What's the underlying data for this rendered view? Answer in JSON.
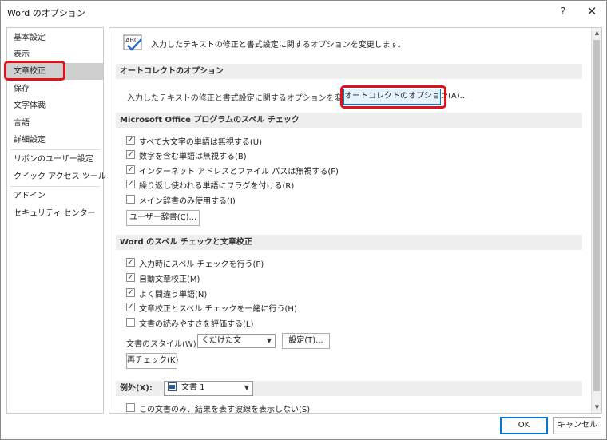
{
  "window": {
    "title": "Word のオプション",
    "help": "?",
    "close": "✕"
  },
  "sidebar": {
    "items": [
      {
        "label": "基本設定"
      },
      {
        "label": "表示"
      },
      {
        "label": "文章校正"
      },
      {
        "label": "保存"
      },
      {
        "label": "文字体裁"
      },
      {
        "label": "言語"
      },
      {
        "label": "詳細設定"
      },
      {
        "label": "リボンのユーザー設定"
      },
      {
        "label": "クイック アクセス ツール バー"
      },
      {
        "label": "アドイン"
      },
      {
        "label": "セキュリティ センター"
      }
    ],
    "selected": "文章校正"
  },
  "header": {
    "icon_label": "ABC",
    "text": "入力したテキストの修正と書式設定に関するオプションを変更します。"
  },
  "autocorrect": {
    "section_title": "オートコレクトのオプション",
    "description": "入力したテキストの修正と書式設定に関するオプションを変更します。",
    "button": "オートコレクトのオプション(A)..."
  },
  "spell_office": {
    "section_title": "Microsoft Office プログラムのスペル チェック",
    "options": [
      {
        "label": "すべて大文字の単語は無視する(U)",
        "checked": "✓"
      },
      {
        "label": "数字を含む単語は無視する(B)",
        "checked": "✓"
      },
      {
        "label": "インターネット アドレスとファイル パスは無視する(F)",
        "checked": "✓"
      },
      {
        "label": "繰り返し使われる単語にフラグを付ける(R)",
        "checked": "✓"
      },
      {
        "label": "メイン辞書のみ使用する(I)",
        "checked": ""
      }
    ],
    "dict_button": "ユーザー辞書(C)..."
  },
  "word_spell": {
    "section_title": "Word のスペル チェックと文章校正",
    "options": [
      {
        "label": "入力時にスペル チェックを行う(P)",
        "checked": "✓"
      },
      {
        "label": "自動文章校正(M)",
        "checked": "✓"
      },
      {
        "label": "よく間違う単語(N)",
        "checked": "✓"
      },
      {
        "label": "文章校正とスペル チェックを一緒に行う(H)",
        "checked": "✓"
      },
      {
        "label": "文書の読みやすさを評価する(L)",
        "checked": ""
      }
    ],
    "style_label": "文書のスタイル(W):",
    "style_value": "くだけた文",
    "settings_button": "設定(T)...",
    "recheck_button": "再チェック(K)"
  },
  "exceptions": {
    "label": "例外(X):",
    "doc_value": "文書 1",
    "option": {
      "label": "この文書のみ、結果を表す波線を表示しない(S)",
      "checked": ""
    }
  },
  "footer": {
    "ok": "OK",
    "cancel": "キャンセル"
  }
}
